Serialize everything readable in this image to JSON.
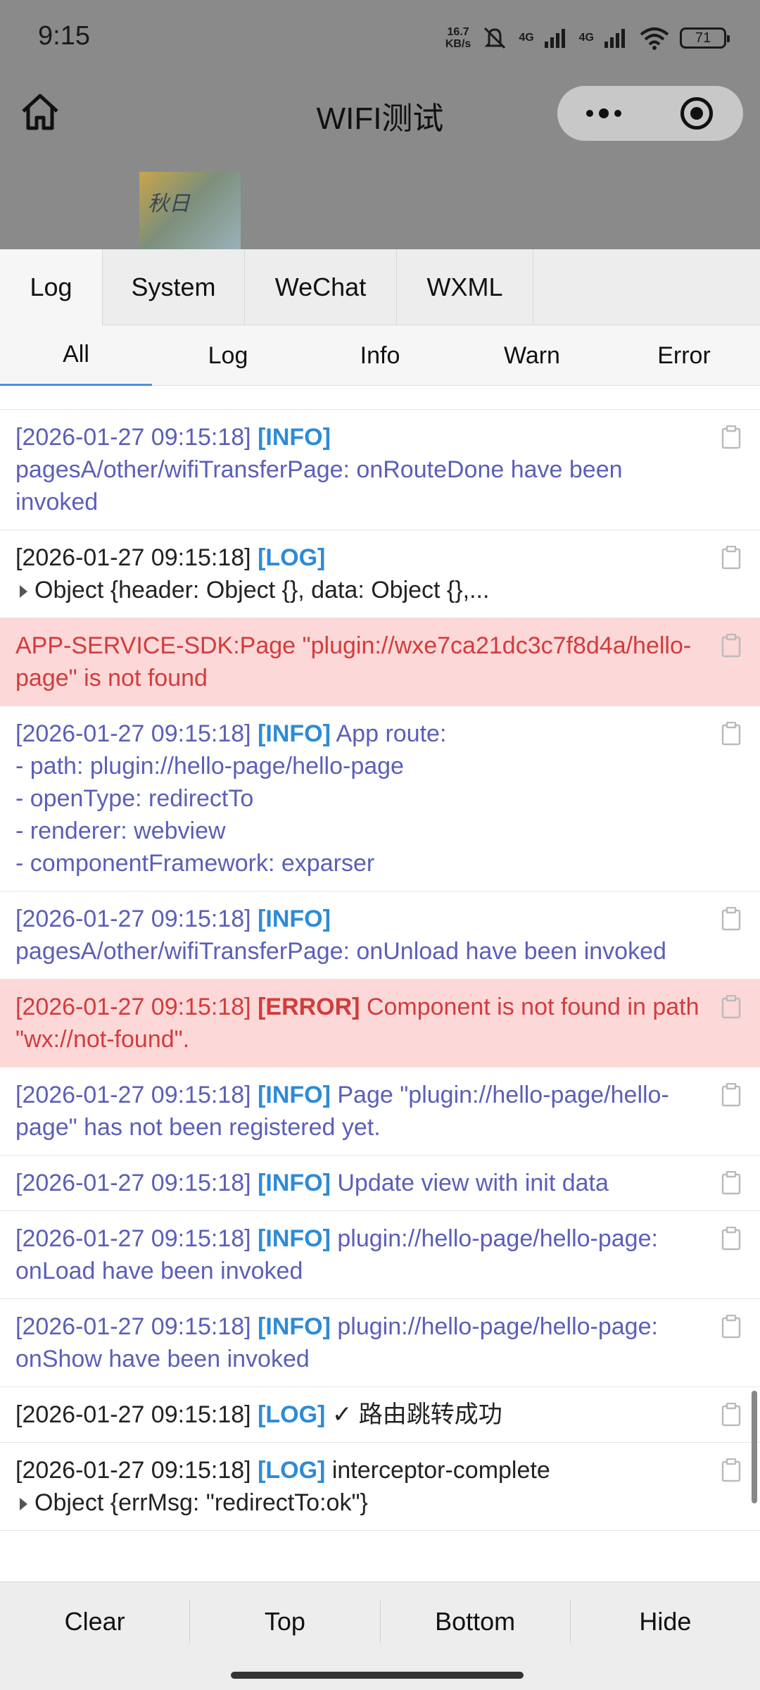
{
  "status_bar": {
    "time": "9:15",
    "net_speed_top": "16.7",
    "net_speed_bottom": "KB/s",
    "signal1": "4G",
    "signal2": "4G",
    "battery": "71"
  },
  "nav": {
    "title": "WIFI测试"
  },
  "thumbnail": {
    "text": "秋日"
  },
  "tabs": [
    {
      "label": "Log"
    },
    {
      "label": "System"
    },
    {
      "label": "WeChat"
    },
    {
      "label": "WXML"
    }
  ],
  "subtabs": [
    {
      "label": "All"
    },
    {
      "label": "Log"
    },
    {
      "label": "Info"
    },
    {
      "label": "Warn"
    },
    {
      "label": "Error"
    }
  ],
  "logs": [
    {
      "ts": "[2026-01-27 09:15:18]",
      "tag": "[INFO]",
      "text": "pagesA/other/wifiTransferPage: onRouteDone have been invoked"
    },
    {
      "ts": "[2026-01-27 09:15:18]",
      "tag": "[LOG]",
      "text": "Object {header: Object {}, data: Object {},..."
    },
    {
      "text": "APP-SERVICE-SDK:Page \"plugin://wxe7ca21dc3c7f8d4a/hello-page\" is not found"
    },
    {
      "ts": "[2026-01-27 09:15:18]",
      "tag": "[INFO]",
      "text": "App route:",
      "lines": [
        "- path: plugin://hello-page/hello-page",
        "- openType: redirectTo",
        "- renderer: webview",
        "- componentFramework: exparser"
      ]
    },
    {
      "ts": "[2026-01-27 09:15:18]",
      "tag": "[INFO]",
      "text": "pagesA/other/wifiTransferPage: onUnload have been invoked"
    },
    {
      "ts": "[2026-01-27 09:15:18]",
      "tag": "[ERROR]",
      "text": "Component is not found in path \"wx://not-found\"."
    },
    {
      "ts": "[2026-01-27 09:15:18]",
      "tag": "[INFO]",
      "text": "Page \"plugin://hello-page/hello-page\" has not been registered yet."
    },
    {
      "ts": "[2026-01-27 09:15:18]",
      "tag": "[INFO]",
      "text": "Update view with init data"
    },
    {
      "ts": "[2026-01-27 09:15:18]",
      "tag": "[INFO]",
      "text": "plugin://hello-page/hello-page: onLoad have been invoked"
    },
    {
      "ts": "[2026-01-27 09:15:18]",
      "tag": "[INFO]",
      "text": "plugin://hello-page/hello-page: onShow have been invoked"
    },
    {
      "ts": "[2026-01-27 09:15:18]",
      "tag": "[LOG]",
      "text": "✓ 路由跳转成功"
    },
    {
      "ts": "[2026-01-27 09:15:18]",
      "tag": "[LOG]",
      "text": "interceptor-complete",
      "object": "Object {errMsg: \"redirectTo:ok\"}"
    }
  ],
  "footer": {
    "clear": "Clear",
    "top": "Top",
    "bottom": "Bottom",
    "hide": "Hide"
  },
  "colors": {
    "info": "#5b5fb8",
    "tag": "#2e8bd6",
    "error": "#d23c3c",
    "error_bg": "#fdd8d8"
  }
}
